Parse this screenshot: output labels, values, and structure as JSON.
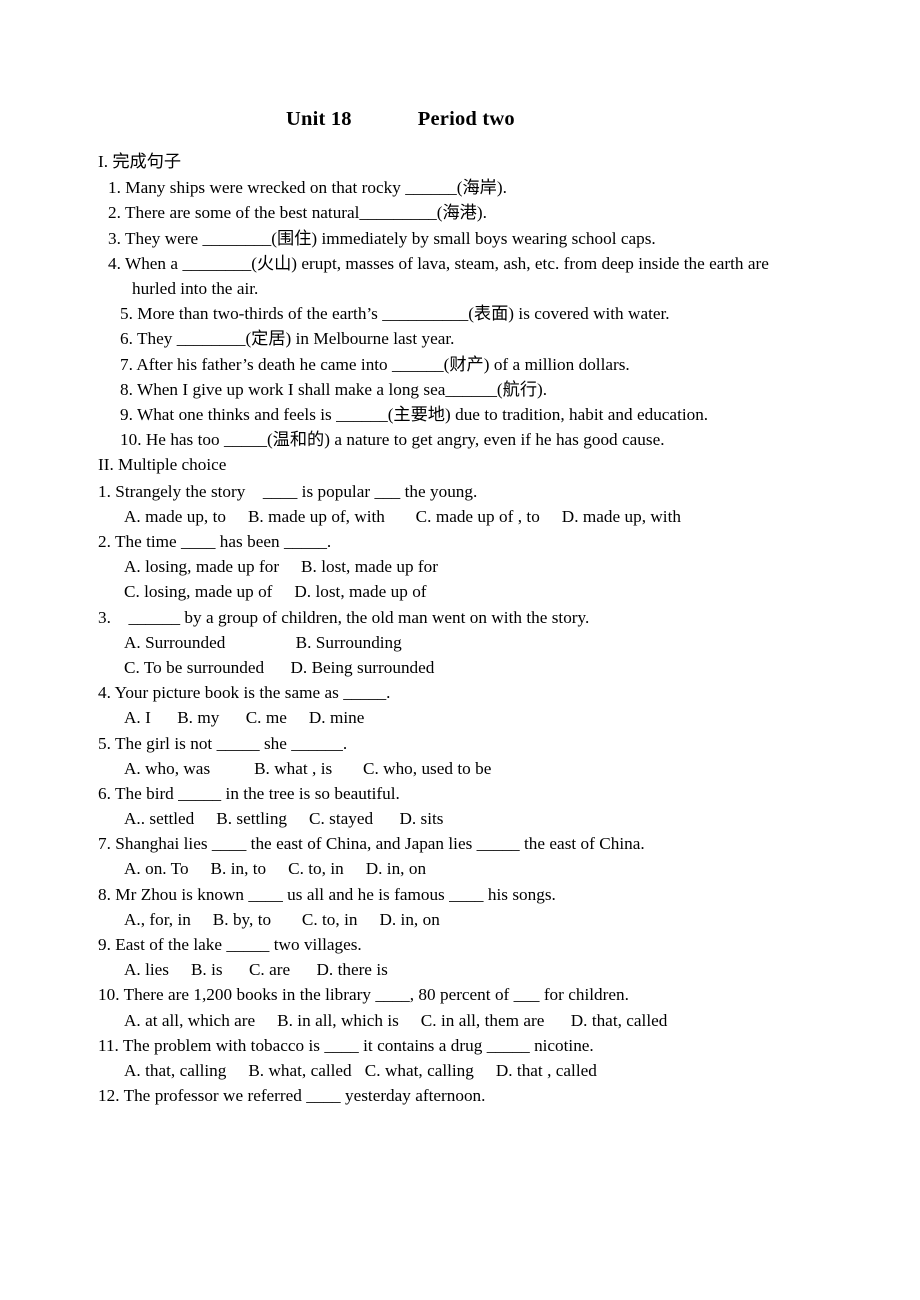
{
  "title": {
    "unit": "Unit 18",
    "period": "Period two"
  },
  "section_one": {
    "heading": "I. 完成句子",
    "items": [
      "1. Many ships were wrecked on that rocky ______(海岸).",
      "2. There are some of the best natural_________(海港).",
      "3. They were ________(围住) immediately by small boys wearing school caps.",
      "4. When a ________(火山) erupt, masses of lava, steam, ash, etc. from deep inside the earth are",
      "hurled into the air.",
      "5. More than two-thirds of the earth’s __________(表面) is covered with water.",
      "6. They ________(定居) in Melbourne last year.",
      "7. After his father’s death he came into ______(财产) of a million dollars.",
      "8. When I give up work I shall make a long sea______(航行).",
      "9. What one thinks and feels is ______(主要地) due to tradition, habit and education.",
      "10. He has too _____(温和的) a nature to get angry, even if he has good cause."
    ]
  },
  "section_two": {
    "heading": "II. Multiple choice",
    "questions": [
      {
        "stem": "1. Strangely the story    ____ is popular ___ the young.",
        "options": [
          "A. made up, to     B. made up of, with       C. made up of , to     D. made up, with"
        ]
      },
      {
        "stem": "2. The time ____ has been _____.",
        "options": [
          "A. losing, made up for     B. lost, made up for",
          "C. losing, made up of     D. lost, made up of"
        ]
      },
      {
        "stem": "3.    ______ by a group of children, the old man went on with the story.",
        "options": [
          "A. Surrounded                B. Surrounding",
          "C. To be surrounded      D. Being surrounded"
        ]
      },
      {
        "stem": "4. Your picture book is the same as _____.",
        "options": [
          "A. I      B. my      C. me     D. mine"
        ]
      },
      {
        "stem": "5. The girl is not _____ she ______.",
        "options": [
          "A. who, was          B. what , is       C. who, used to be"
        ]
      },
      {
        "stem": "6. The bird _____ in the tree is so beautiful.",
        "options": [
          "A.. settled     B. settling     C. stayed      D. sits"
        ]
      },
      {
        "stem": "7. Shanghai lies ____ the east of China, and Japan lies _____ the east of China.",
        "options": [
          "A. on. To     B. in, to     C. to, in     D. in, on"
        ]
      },
      {
        "stem": "8. Mr Zhou is known ____ us all and he is famous ____ his songs.",
        "options": [
          "A., for, in     B. by, to       C. to, in     D. in, on"
        ]
      },
      {
        "stem": "9. East of the lake _____ two villages.",
        "options": [
          "A. lies     B. is      C. are      D. there is"
        ]
      },
      {
        "stem": "10. There are 1,200 books in the library ____, 80 percent of ___ for children.",
        "options": [
          "A. at all, which are     B. in all, which is     C. in all, them are      D. that, called"
        ]
      },
      {
        "stem": "11. The problem with tobacco is ____ it contains a drug _____ nicotine.",
        "options": [
          "A. that, calling     B. what, called   C. what, calling     D. that , called"
        ]
      },
      {
        "stem": "12. The professor we referred ____ yesterday afternoon.",
        "options": []
      }
    ]
  }
}
